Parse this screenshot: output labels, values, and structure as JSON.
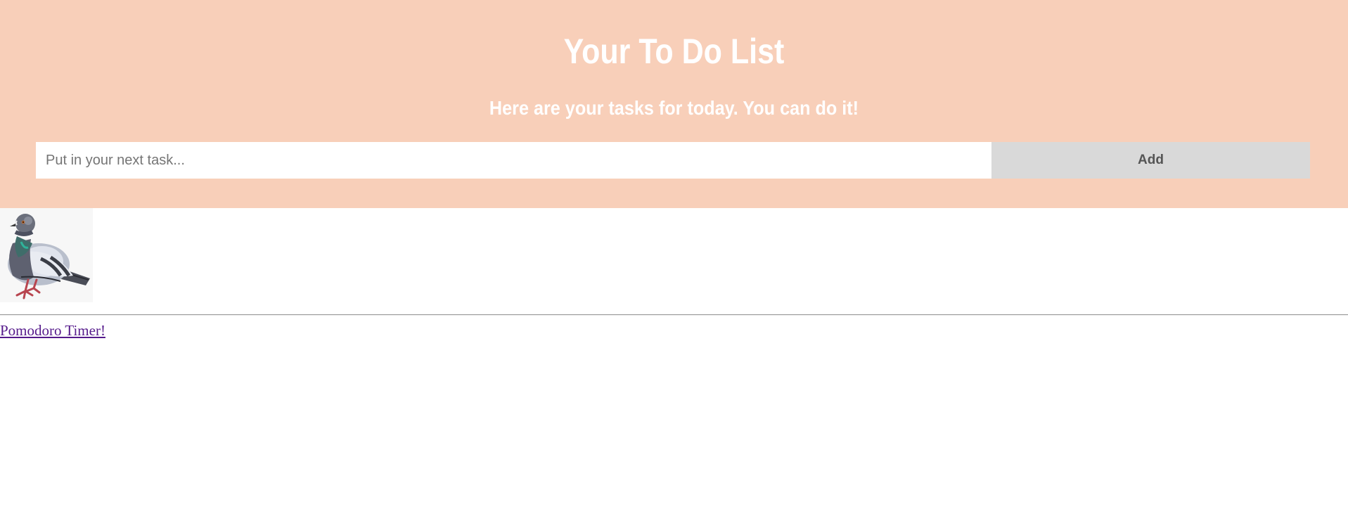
{
  "header": {
    "title": "Your To Do List",
    "subtitle": "Here are your tasks for today. You can do it!",
    "background": "#f8cfb9"
  },
  "task_form": {
    "input_placeholder": "Put in your next task...",
    "input_value": "",
    "add_label": "Add"
  },
  "image": {
    "subject": "pigeon-illustration"
  },
  "footer": {
    "timer_link": "Pomodoro Timer!",
    "link_color": "#551a8b"
  }
}
